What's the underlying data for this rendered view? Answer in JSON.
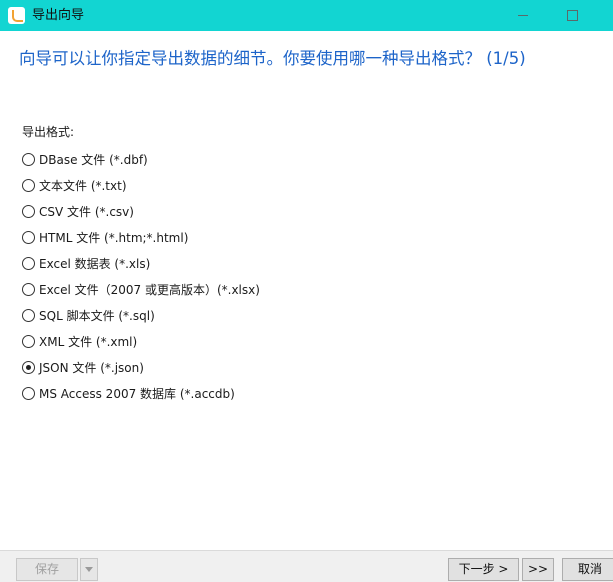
{
  "window": {
    "title": "导出向导"
  },
  "header": {
    "question": "向导可以让你指定导出数据的细节。你要使用哪一种导出格式？ (1/5)"
  },
  "format_group": {
    "label": "导出格式:",
    "selected_index": 8,
    "options": [
      {
        "label": "DBase 文件 (*.dbf)",
        "selected": false
      },
      {
        "label": "文本文件 (*.txt)",
        "selected": false
      },
      {
        "label": "CSV 文件 (*.csv)",
        "selected": false
      },
      {
        "label": "HTML 文件 (*.htm;*.html)",
        "selected": false
      },
      {
        "label": "Excel 数据表 (*.xls)",
        "selected": false
      },
      {
        "label": "Excel 文件（2007 或更高版本）(*.xlsx)",
        "selected": false
      },
      {
        "label": "SQL 脚本文件 (*.sql)",
        "selected": false
      },
      {
        "label": "XML 文件 (*.xml)",
        "selected": false
      },
      {
        "label": "JSON 文件 (*.json)",
        "selected": true
      },
      {
        "label": "MS Access 2007 数据库 (*.accdb)",
        "selected": false
      }
    ]
  },
  "footer": {
    "save_label": "保存",
    "next_label": "下一步 >",
    "last_label": ">>",
    "cancel_label": "取消"
  },
  "colors": {
    "titlebar": "#12d5d2",
    "question_text": "#1d64c9",
    "footer_bg": "#f0f0f0"
  },
  "icons": {
    "app": "app-logo-icon",
    "minimize": "minimize-icon",
    "maximize": "maximize-icon",
    "dropdown": "chevron-down-icon"
  }
}
